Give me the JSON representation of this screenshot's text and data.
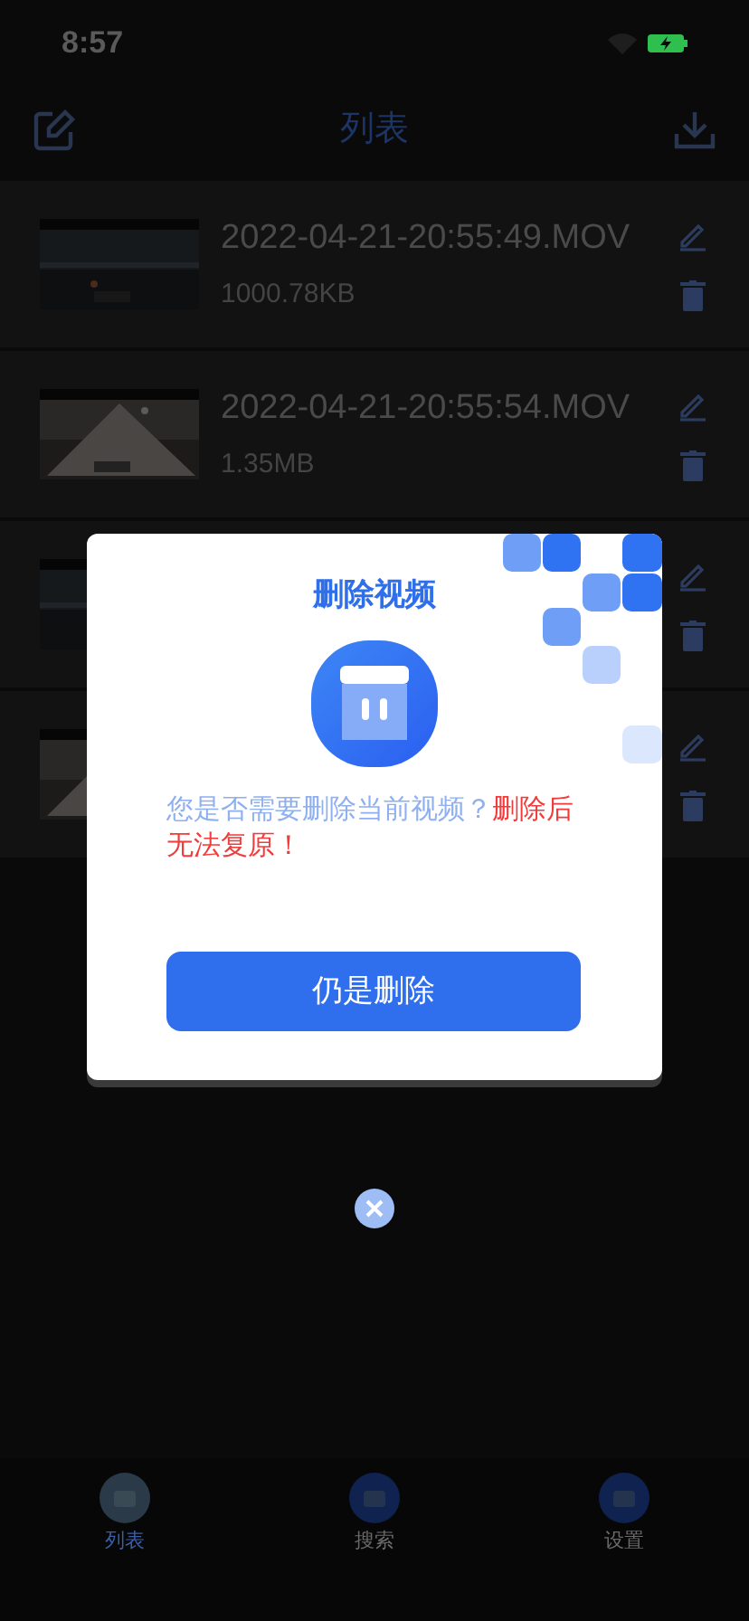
{
  "status_bar": {
    "time": "8:57"
  },
  "header": {
    "title": "列表"
  },
  "videos": [
    {
      "thumbnail": {
        "kind": "picture"
      },
      "name": "2022-04-21-20:55:49.MOV",
      "size": "1000.78KB"
    },
    {
      "thumbnail": {
        "kind": "picture"
      },
      "name": "2022-04-21-20:55:54.MOV",
      "size": "1.35MB"
    },
    {
      "thumbnail": {
        "kind": "picture"
      }
    },
    {
      "thumbnail": {
        "kind": "picture"
      }
    }
  ],
  "dialog": {
    "title": "删除视频",
    "message": "您是否需要删除当前视频？",
    "warning": "删除后无法复原！",
    "button": "仍是删除"
  },
  "tabs": [
    {
      "label": "列表",
      "selected": true
    },
    {
      "label": "搜索",
      "selected": false
    },
    {
      "label": "设置",
      "selected": false
    }
  ]
}
